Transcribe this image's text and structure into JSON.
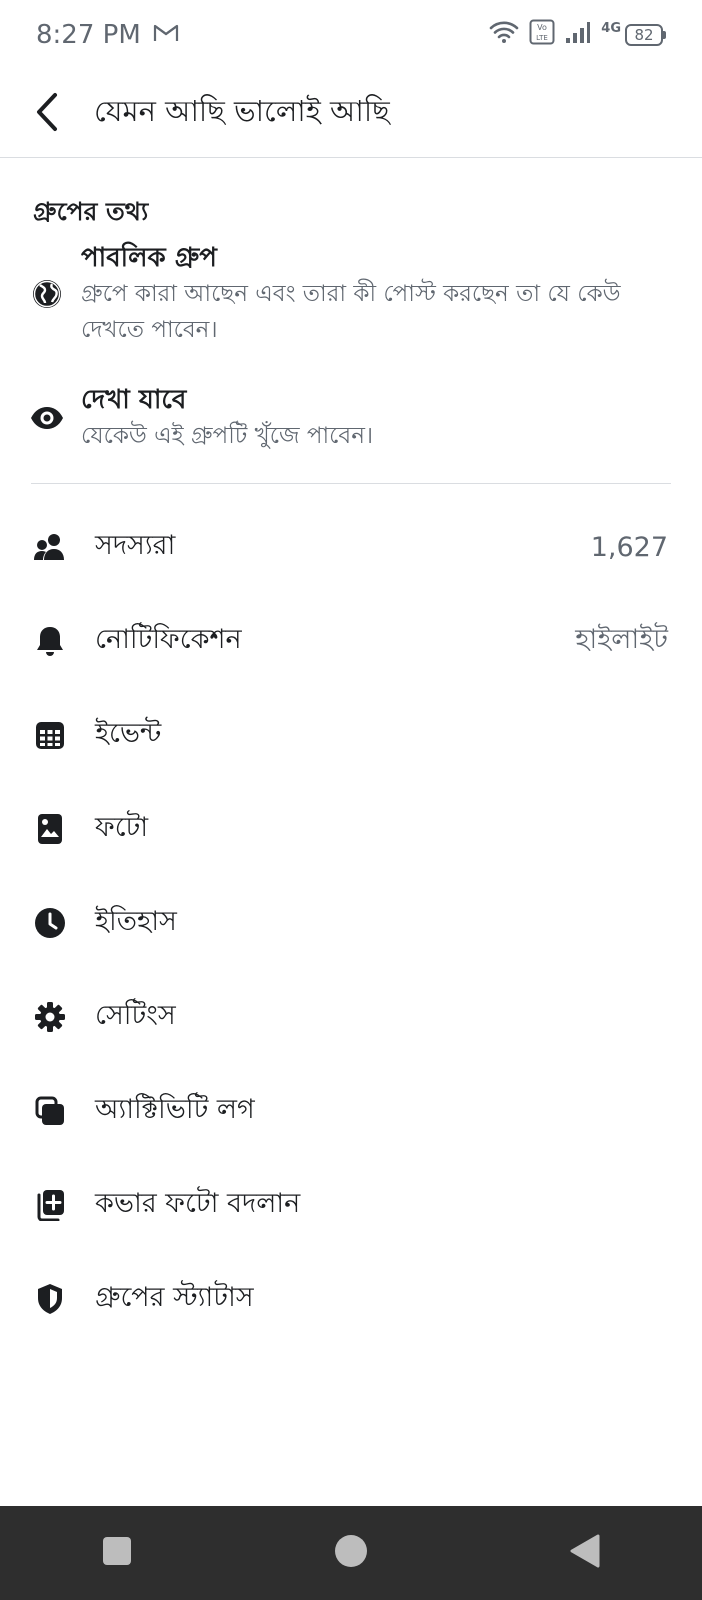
{
  "status_bar": {
    "time": "8:27 PM",
    "network_label": "4G",
    "battery_level": "82",
    "icons": [
      "gmail-icon",
      "wifi-icon",
      "volte-icon",
      "signal-icon",
      "battery-icon"
    ]
  },
  "header": {
    "title": "যেমন আছি ভালোই আছি",
    "back_icon": "back-arrow-icon"
  },
  "group_info": {
    "section_title": "গ্রুপের তথ্য",
    "privacy": {
      "icon": "globe-icon",
      "title": "পাবলিক গ্রুপ",
      "description_line1": "গ্রুপে কারা আছেন এবং তারা কী পোস্ট করছেন তা যে কেউ",
      "description_line2": "দেখতে পাবেন।"
    },
    "visibility": {
      "icon": "eye-icon",
      "title": "দেখা যাবে",
      "description": "যেকেউ এই গ্রুপটি খুঁজে পাবেন।"
    }
  },
  "menu": [
    {
      "icon": "members-icon",
      "label": "সদস্যরা",
      "value": "1,627"
    },
    {
      "icon": "bell-icon",
      "label": "নোটিফিকেশন",
      "value": "হাইলাইট"
    },
    {
      "icon": "calendar-icon",
      "label": "ইভেন্ট",
      "value": ""
    },
    {
      "icon": "photo-icon",
      "label": "ফটো",
      "value": ""
    },
    {
      "icon": "clock-icon",
      "label": "ইতিহাস",
      "value": ""
    },
    {
      "icon": "gear-icon",
      "label": "সেটিংস",
      "value": ""
    },
    {
      "icon": "activity-log-icon",
      "label": "অ্যাক্টিভিটি লগ",
      "value": ""
    },
    {
      "icon": "add-photo-icon",
      "label": "কভার ফটো বদলান",
      "value": ""
    },
    {
      "icon": "shield-icon",
      "label": "গ্রুপের স্ট্যাটাস",
      "value": ""
    }
  ],
  "colors": {
    "text_primary": "#1c1e21",
    "text_secondary": "#606770",
    "divider": "#dadde1",
    "nav_bar": "#2e2e2e",
    "nav_icon": "#bdbdbd"
  }
}
